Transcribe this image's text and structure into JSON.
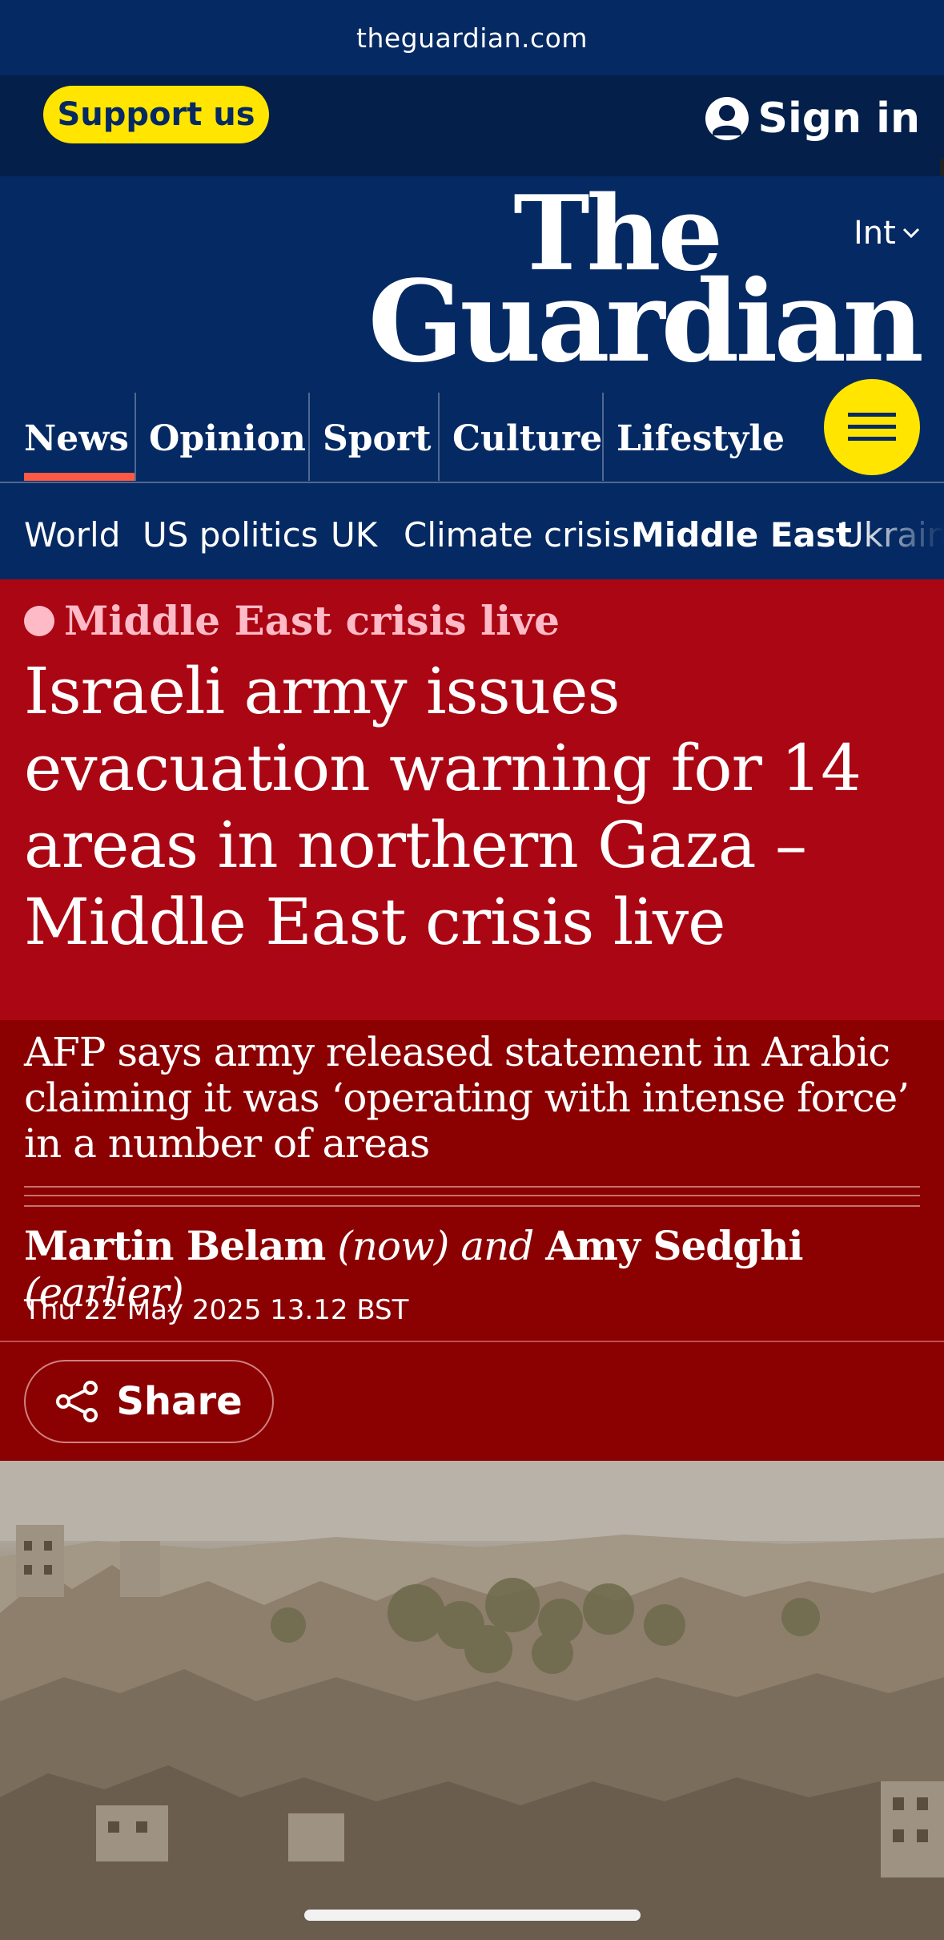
{
  "browser": {
    "url": "theguardian.com"
  },
  "topbar": {
    "support_label": "Support us",
    "signin_label": "Sign in"
  },
  "masthead": {
    "edition_label": "Int",
    "logo_line1": "The",
    "logo_line2": "Guardian",
    "pillars": [
      {
        "label": "News",
        "active": true
      },
      {
        "label": "Opinion"
      },
      {
        "label": "Sport"
      },
      {
        "label": "Culture"
      },
      {
        "label": "Lifestyle"
      }
    ],
    "accent_color": "#ff5943",
    "brand_color": "#052962",
    "menu_color": "#ffe500"
  },
  "subnav": {
    "items": [
      "World",
      "US politics",
      "UK",
      "Climate crisis",
      "Middle East",
      "Ukraine"
    ],
    "active": "Middle East"
  },
  "article": {
    "kicker": "Middle East crisis live",
    "headline": "Israeli army issues evacuation warning for 14 areas in northern Gaza – Middle East crisis live",
    "standfirst": "AFP says army released statement in Arabic claiming it was ‘operating with intense force’ in a number of areas",
    "byline": {
      "author1": "Martin Belam",
      "author1_note": "(now)",
      "conjunction": "and",
      "author2": "Amy Sedghi",
      "author2_note": "(earlier)"
    },
    "date": "Thu 22 May 2025 13.12 BST",
    "share_label": "Share",
    "live_color": "#ab0613"
  },
  "icons": [
    "account-icon",
    "chevron-down-icon",
    "hamburger-menu-icon",
    "share-icon",
    "live-dot-icon"
  ]
}
